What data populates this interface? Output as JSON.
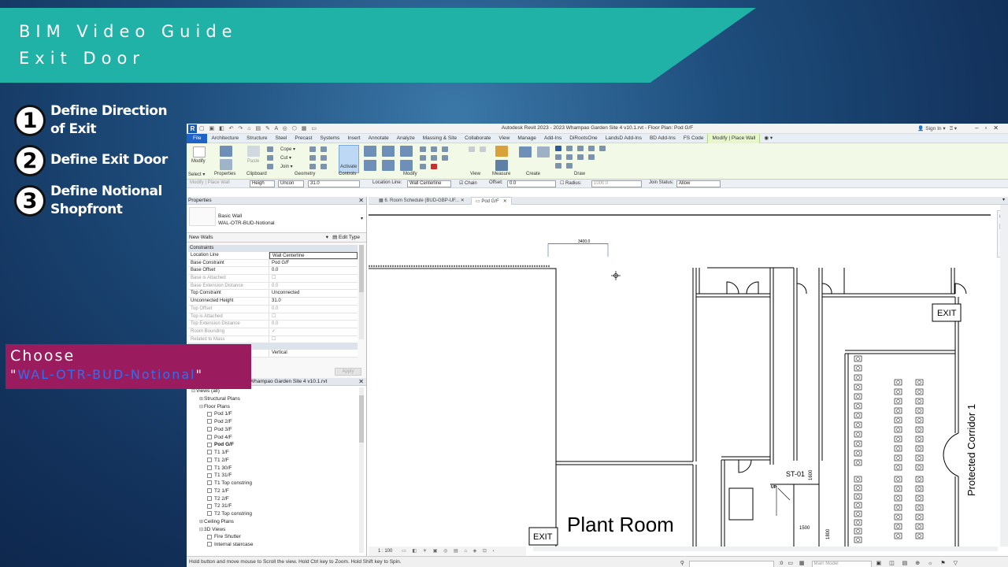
{
  "guide": {
    "title": "BIM Video Guide",
    "subtitle": "Exit Door",
    "steps": [
      {
        "num": "1",
        "text": "Define Direction of Exit"
      },
      {
        "num": "2",
        "text": "Define Exit Door"
      },
      {
        "num": "3",
        "text": "Define Notional Shopfront"
      }
    ],
    "callout": {
      "title": "Choose",
      "value": "WAL-OTR-BUD-Notional"
    }
  },
  "window": {
    "logo": "R",
    "title": "Autodesk Revit 2023 - 2023 Whampao Garden Site 4 v10.1.rvt - Floor Plan: Pod G/F",
    "signin": "Sign In"
  },
  "ribbon_tabs": [
    "File",
    "Architecture",
    "Structure",
    "Steel",
    "Precast",
    "Systems",
    "Insert",
    "Annotate",
    "Analyze",
    "Massing & Site",
    "Collaborate",
    "View",
    "Manage",
    "Add-Ins",
    "DiRootsOne",
    "LandsD Add-Ins",
    "BD Add-Ins",
    "FS Code",
    "Modify | Place Wall"
  ],
  "ribbon_groups": {
    "select": "Select ▾",
    "properties": "Properties",
    "clipboard": "Clipboard",
    "geometry": "Geometry",
    "controls": "Controls",
    "modify": "Modify",
    "view": "View",
    "measure": "Measure",
    "create": "Create",
    "draw": "Draw",
    "modify_btn": "Modify",
    "paste": "Paste",
    "cope": "Cope ▾",
    "cut": "Cut ▾",
    "join": "Join ▾",
    "activate": "Activate"
  },
  "options_bar": {
    "context": "Modify | Place Wall",
    "height_mode": "Heigh",
    "height_value": "Uncon",
    "height_number": "31.0",
    "location_line_label": "Location Line:",
    "location_line_value": "Wall Centerline",
    "chain": "Chain",
    "offset_label": "Offset:",
    "offset_value": "0.0",
    "radius_label": "Radius:",
    "radius_value": "1000.0",
    "join_status_label": "Join Status:",
    "join_status_value": "Allow"
  },
  "properties": {
    "header": "Properties",
    "type_family": "Basic Wall",
    "type_name": "WAL-OTR-BUD-Notional",
    "instance_filter": "New Walls",
    "edit_type": "Edit Type",
    "section_constraints": "Constraints",
    "rows": [
      {
        "label": "Location Line",
        "value": "Wall Centerline"
      },
      {
        "label": "Base Constraint",
        "value": "Pod G/F"
      },
      {
        "label": "Base Offset",
        "value": "0.0"
      },
      {
        "label": "Base is Attached",
        "value": ""
      },
      {
        "label": "Base Extension Distance",
        "value": "0.0"
      },
      {
        "label": "Top Constraint",
        "value": "Unconnected"
      },
      {
        "label": "Unconnected Height",
        "value": "31.0"
      },
      {
        "label": "Top Offset",
        "value": "0.0"
      },
      {
        "label": "Top is Attached",
        "value": ""
      },
      {
        "label": "Top Extension Distance",
        "value": "0.0"
      },
      {
        "label": "Room Bounding",
        "value": "✓"
      },
      {
        "label": "Related to Mass",
        "value": ""
      }
    ],
    "extra_value": "Vertical",
    "apply": "Apply"
  },
  "browser": {
    "header": "Whampao Garden Site 4 v10.1.rvt",
    "nodes": [
      {
        "label": "Views (all)",
        "level": 0,
        "exp": "⊟"
      },
      {
        "label": "Structural Plans",
        "level": 1,
        "exp": "⊞"
      },
      {
        "label": "Floor Plans",
        "level": 1,
        "exp": "⊟"
      },
      {
        "label": "Pod 1/F",
        "level": 2
      },
      {
        "label": "Pod 2/F",
        "level": 2
      },
      {
        "label": "Pod 3/F",
        "level": 2
      },
      {
        "label": "Pod 4/F",
        "level": 2
      },
      {
        "label": "Pod G/F",
        "level": 2,
        "bold": true
      },
      {
        "label": "T1 1/F",
        "level": 2
      },
      {
        "label": "T1 2/F",
        "level": 2
      },
      {
        "label": "T1 30/F",
        "level": 2
      },
      {
        "label": "T1 31/F",
        "level": 2
      },
      {
        "label": "T1 Top constring",
        "level": 2
      },
      {
        "label": "T2 1/F",
        "level": 2
      },
      {
        "label": "T2 2/F",
        "level": 2
      },
      {
        "label": "T2 31/F",
        "level": 2
      },
      {
        "label": "T2 Top constring",
        "level": 2
      },
      {
        "label": "Ceiling Plans",
        "level": 1,
        "exp": "⊞"
      },
      {
        "label": "3D Views",
        "level": 1,
        "exp": "⊟"
      },
      {
        "label": "Fire Shutter",
        "level": 2
      },
      {
        "label": "Internal staircase",
        "level": 2
      }
    ]
  },
  "view_tabs": [
    "6. Room Schedule (BUD-GBP-UF...",
    "Pod G/F"
  ],
  "plan": {
    "dimension": "3400.0",
    "exit_labels": [
      "EXIT",
      "EXIT"
    ],
    "room_name": "Plant Room",
    "corridor": "Protected Corridor 1",
    "stair_tag": "ST-01",
    "dim_1600": "1600",
    "dim_1500": "1500",
    "dim_1800": "1800",
    "up": "UP"
  },
  "view_control": {
    "scale": "1 : 100"
  },
  "status": {
    "hint": "Hold button and move mouse to Scroll the view. Hold Ctrl key to Zoom. Hold Shift key to Spin.",
    "zero": ":0",
    "model": "Main Model"
  }
}
